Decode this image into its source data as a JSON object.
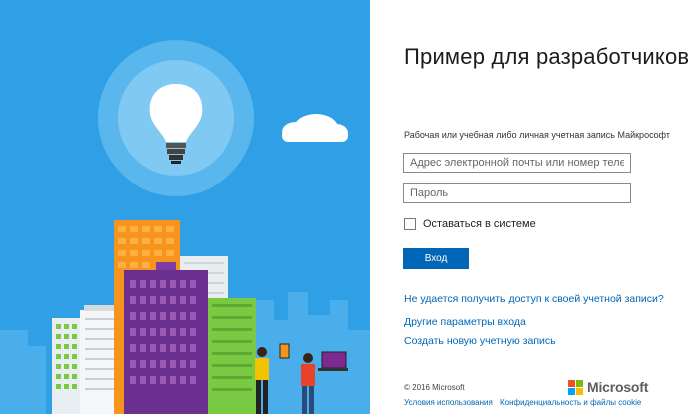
{
  "title": "Пример для разработчиков",
  "subtitle": "Рабочая или учебная либо личная учетная запись Майкрософт",
  "email": {
    "placeholder": "Адрес электронной почты или номер телефона",
    "value": ""
  },
  "password": {
    "placeholder": "Пароль",
    "value": ""
  },
  "remember": {
    "label": "Оставаться в системе",
    "checked": false
  },
  "signin_button": "Вход",
  "links": {
    "cant_access": "Не удается получить доступ к своей учетной записи?",
    "other_options": "Другие параметры входа",
    "create_account": "Создать новую учетную запись"
  },
  "footer": {
    "copyright": "© 2016 Microsoft",
    "terms": "Условия использования",
    "privacy": "Конфиденциальность и файлы cookie",
    "brand": "Microsoft"
  },
  "colors": {
    "art_bg": "#2f9fe6",
    "accent": "#0067b8",
    "ms_red": "#f25022",
    "ms_green": "#7fba00",
    "ms_blue": "#00a4ef",
    "ms_yellow": "#ffb900"
  }
}
